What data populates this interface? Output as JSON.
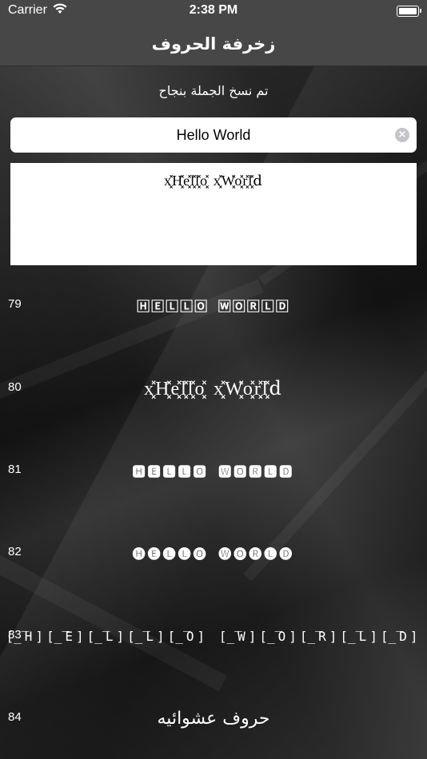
{
  "status_bar": {
    "carrier": "Carrier",
    "time": "2:38 PM"
  },
  "nav": {
    "title": "زخرفة الحروف"
  },
  "toast": "تم نسخ الجملة بنجاح",
  "input": {
    "value": "Hello World",
    "placeholder": ""
  },
  "output": "x͓̽H͓̽e͓̽l͓̽l͓̽o͓̽ x͓̽W͓̽o͓̽r͓̽l͓̽d",
  "rows": [
    {
      "number": "79",
      "text": "🄷🄴🄻🄻🄾 🅆🄾🅁🄻🄳"
    },
    {
      "number": "80",
      "text": "x͓̽H͓̽e͓̽l͓̽l͓̽o͓̽ x͓̽W͓̽o͓̽r͓̽l͓̽d"
    },
    {
      "number": "81",
      "text": "🅷🅴🅻🅻🅾 🆆🅾🆁🅻🅳"
    },
    {
      "number": "82",
      "text": "🅗🅔🅛🅛🅞 🅦🅞🅡🅛🅓"
    },
    {
      "number": "83",
      "text": "[̲̅H][̲̅E][̲̅L][̲̅L][̲̅O] [̲̅W][̲̅O][̲̅R][̲̅L][̲̅D]"
    },
    {
      "number": "84",
      "text": "حروف عشوائيه"
    }
  ]
}
